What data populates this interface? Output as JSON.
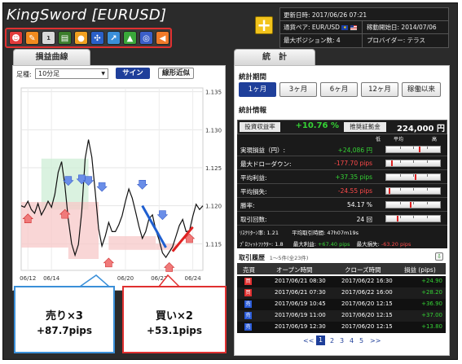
{
  "app": {
    "title": "KingSword [EURUSD]"
  },
  "toolbar_icons": [
    {
      "name": "smile-icon",
      "color": "#e23b3b",
      "glyph": "☻"
    },
    {
      "name": "pencil-icon",
      "color": "#f18a1e",
      "glyph": "✎"
    },
    {
      "name": "top-rank-icon",
      "color": "#d9d9d9",
      "glyph": "1"
    },
    {
      "name": "book-icon",
      "color": "#3b7d2b",
      "glyph": "▤"
    },
    {
      "name": "medal-icon",
      "color": "#f0a020",
      "glyph": "●"
    },
    {
      "name": "network-icon",
      "color": "#2a60c8",
      "glyph": "✣"
    },
    {
      "name": "chart-up-icon",
      "color": "#3a8fd8",
      "glyph": "↗"
    },
    {
      "name": "arrow-up-icon",
      "color": "#3aa83a",
      "glyph": "▲"
    },
    {
      "name": "target-icon",
      "color": "#3b5fc9",
      "glyph": "◎"
    },
    {
      "name": "megaphone-icon",
      "color": "#f07a2a",
      "glyph": "◀"
    }
  ],
  "info": {
    "updated_label": "更新日時:",
    "updated_value": "2017/06/26 07:21",
    "pair_label": "通貨ペア:",
    "pair_value": "EUR/USD",
    "start_label": "稼動開始日:",
    "start_value": "2014/07/06",
    "maxpos_label": "最大ポジション数:",
    "maxpos_value": "4",
    "provider_label": "プロバイダー:",
    "provider_value": "テラス"
  },
  "tabs": {
    "left": "損益曲線",
    "right": "統　計"
  },
  "chart_controls": {
    "timeframe_label": "足種:",
    "timeframe_value": "10分足",
    "sign_button": "サイン",
    "fit_button": "線形近似"
  },
  "chart_data": {
    "type": "line",
    "xlabel": "",
    "ylabel": "",
    "x_ticks": [
      "06/12",
      "06/14",
      "06/20",
      "06/22",
      "06/24"
    ],
    "ylim": [
      1.1115,
      1.1355
    ],
    "y_ticks": [
      1.135,
      1.13,
      1.125,
      1.12,
      1.115
    ],
    "series": [
      {
        "values": [
          1.12,
          1.1198,
          1.1206,
          1.1195,
          1.119,
          1.1203,
          1.1188,
          1.1196,
          1.1206,
          1.1198,
          1.1215,
          1.1244,
          1.1258,
          1.1226,
          1.1182,
          1.115,
          1.1135,
          1.1149,
          1.1192,
          1.1262,
          1.1287,
          1.1264,
          1.1218,
          1.117,
          1.1147,
          1.116,
          1.1178,
          1.1166,
          1.1166,
          1.1175,
          1.1187,
          1.1206,
          1.1222,
          1.121,
          1.1192,
          1.1173,
          1.1157,
          1.1166,
          1.1183,
          1.1188,
          1.1168,
          1.1155,
          1.1138,
          1.1132,
          1.1139,
          1.1146,
          1.116,
          1.1174,
          1.1182,
          1.1166,
          1.1167,
          1.1186,
          1.1202,
          1.1195,
          1.12
        ]
      }
    ],
    "sell_markers": [
      [
        14,
        1.123
      ],
      [
        18,
        1.1232
      ],
      [
        20,
        1.123
      ],
      [
        24,
        1.1222
      ],
      [
        36,
        1.1225
      ],
      [
        42,
        1.1185
      ]
    ],
    "buy_markers": [
      [
        2,
        1.1186
      ],
      [
        13,
        1.1192
      ],
      [
        26,
        1.1128
      ],
      [
        44,
        1.1122
      ],
      [
        50,
        1.116
      ]
    ],
    "sell_regions": [
      [
        6,
        20,
        1.1195,
        1.1262
      ]
    ],
    "buy_regions": [
      [
        0,
        14,
        1.1145,
        1.1205
      ],
      [
        14,
        23,
        1.113,
        1.1205
      ],
      [
        26,
        40,
        1.1142,
        1.116
      ],
      [
        40,
        46,
        1.1142,
        1.115
      ]
    ],
    "sell_trend_lines": [
      [
        36,
        1.12,
        43,
        1.1145
      ]
    ],
    "buy_trend_lines": [
      [
        45,
        1.114,
        51,
        1.1172
      ]
    ]
  },
  "callouts": {
    "sell_title": "売り×3",
    "sell_value": "+87.7pips",
    "buy_title": "買い×2",
    "buy_value": "+53.1pips"
  },
  "stats": {
    "period_title": "統計期間",
    "periods": [
      "1ヶ月",
      "3ヶ月",
      "6ヶ月",
      "12ヶ月",
      "稼働以来"
    ],
    "info_title": "統計情報",
    "roi_label": "投資収益率",
    "roi_value": "+10.76 %",
    "margin_label": "推奨証拠金",
    "margin_value": "224,000 円",
    "scale_low": "低",
    "scale_mid": "平均",
    "scale_high": "高",
    "rows": [
      {
        "label": "実現損益（円）:",
        "value": "+24,086 円",
        "color": "#35d335",
        "marker": 0.62
      },
      {
        "label": "最大ドローダウン:",
        "value": "-177.70 pips",
        "color": "#ff4a4a",
        "marker": 0.1
      },
      {
        "label": "平均利益:",
        "value": "+37.35 pips",
        "color": "#35d335",
        "marker": 0.55
      },
      {
        "label": "平均損失:",
        "value": "-24.55 pips",
        "color": "#ff4a4a",
        "marker": 0.05
      },
      {
        "label": "勝率:",
        "value": "54.17 %",
        "color": "#ffffff",
        "marker": 0.45
      },
      {
        "label": "取引回数:",
        "value": "24 回",
        "color": "#ffffff",
        "marker": 0.2
      }
    ],
    "extra1": {
      "rf_label": "ﾘｽｸﾘﾀｰﾝ率:",
      "rf_value": "1.21",
      "avgtime_label": "平均取引時間:",
      "avgtime_value": "47h07m19s"
    },
    "extra2": {
      "pf_label": "ﾌﾟﾛﾌｨｯﾄﾌｧｸﾀｰ:",
      "pf_value": "1.8",
      "maxprofit_label": "最大利益:",
      "maxprofit_value": "+67.40 pips",
      "maxloss_label": "最大損失:",
      "maxloss_value": "-63.20 pips"
    }
  },
  "history": {
    "title": "取引履歴",
    "subtitle": "1～5件(全23件)",
    "headers": [
      "売買",
      "オープン時間",
      "クローズ時間",
      "損益 (pips)"
    ],
    "rows": [
      {
        "side": "買",
        "side_color": "#e03030",
        "open": "2017/06/21 08:30",
        "close": "2017/06/22 16:30",
        "pl": "+24.90"
      },
      {
        "side": "買",
        "side_color": "#e03030",
        "open": "2017/06/21 07:30",
        "close": "2017/06/22 16:00",
        "pl": "+28.20"
      },
      {
        "side": "売",
        "side_color": "#2a5bd8",
        "open": "2017/06/19 10:45",
        "close": "2017/06/20 12:15",
        "pl": "+36.90"
      },
      {
        "side": "売",
        "side_color": "#2a5bd8",
        "open": "2017/06/19 11:00",
        "close": "2017/06/20 12:15",
        "pl": "+37.00"
      },
      {
        "side": "売",
        "side_color": "#2a5bd8",
        "open": "2017/06/19 12:30",
        "close": "2017/06/20 12:15",
        "pl": "+13.80"
      }
    ],
    "pagination": {
      "prev": "<<",
      "pages": [
        "1",
        "2",
        "3",
        "4",
        "5"
      ],
      "current": "1",
      "next": ">>"
    }
  }
}
